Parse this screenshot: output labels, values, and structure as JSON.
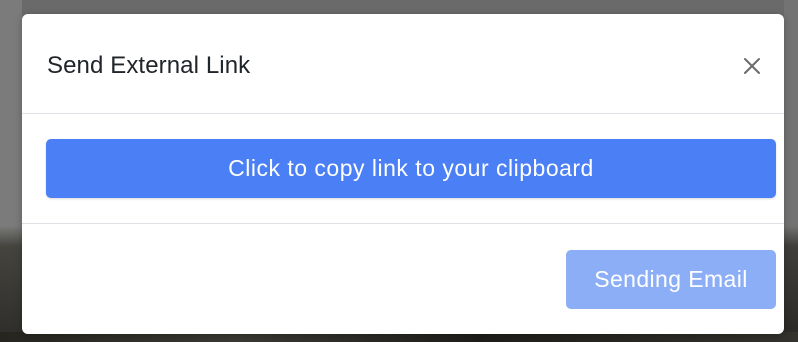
{
  "modal": {
    "title": "Send External Link",
    "close_icon": "close-icon",
    "copy_button_label": "Click to copy link to your clipboard",
    "sending_button_label": "Sending Email"
  },
  "colors": {
    "primary": "#4a7ff5",
    "primary_disabled": "#8caef7",
    "divider": "#dee2e6",
    "title_text": "#212529",
    "close_icon": "#6c6c6c"
  }
}
